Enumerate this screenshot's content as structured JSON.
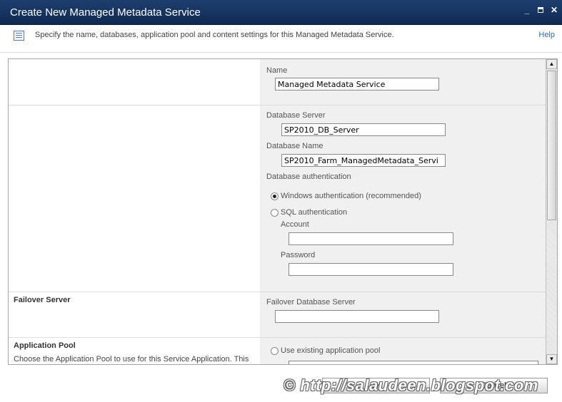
{
  "window": {
    "title": "Create New Managed Metadata Service",
    "minimize_glyph": "_",
    "close_glyph": "✕"
  },
  "instructions": {
    "text": "Specify the name, databases, application pool and content settings for this Managed Metadata Service.",
    "help_label": "Help",
    "icon": "document-list-icon"
  },
  "form": {
    "name": {
      "label": "Name",
      "value": "Managed Metadata Service"
    },
    "database": {
      "server_label": "Database Server",
      "server_value": "SP2010_DB_Server",
      "name_label": "Database Name",
      "name_value": "SP2010_Farm_ManagedMetadata_Servi",
      "auth_label": "Database authentication",
      "windows_auth_label": "Windows authentication (recommended)",
      "windows_auth_selected": true,
      "sql_auth_label": "SQL authentication",
      "sql_auth_selected": false,
      "account_label": "Account",
      "account_value": "",
      "password_label": "Password",
      "password_value": ""
    },
    "failover": {
      "section_title": "Failover Server",
      "label": "Failover Database Server",
      "value": ""
    },
    "app_pool": {
      "section_title": "Application Pool",
      "description": "Choose the Application Pool to use for this Service Application.  This",
      "use_existing_label": "Use existing application pool",
      "use_existing_selected": false
    }
  },
  "scrollbar": {
    "up_glyph": "▲",
    "down_glyph": "▼"
  },
  "buttons": {
    "ok_label": "OK",
    "cancel_label": "Cancel"
  },
  "watermark": "© http://salaudeen.blogspot.com",
  "colors": {
    "titlebar": "#143562",
    "link": "#2970b6",
    "right_panel": "#f0f0f0"
  }
}
